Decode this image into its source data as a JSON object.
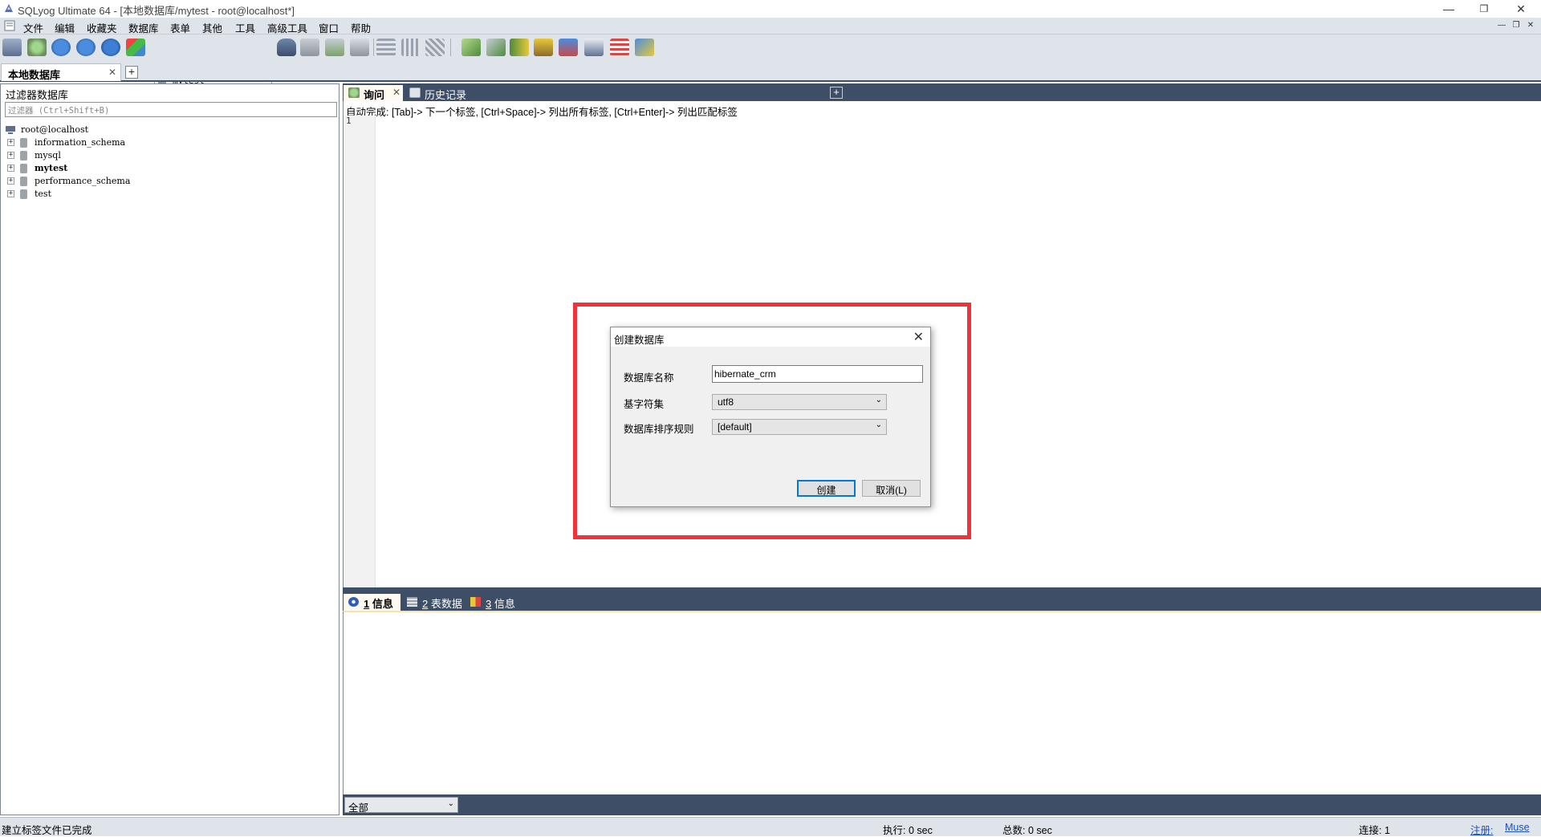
{
  "window": {
    "title": "SQLyog Ultimate 64 - [本地数据库/mytest - root@localhost*]",
    "controls": [
      "—",
      "❐",
      "✕"
    ]
  },
  "menu": {
    "items": [
      "文件",
      "编辑",
      "收藏夹",
      "数据库",
      "表单",
      "其他",
      "工具",
      "高级工具",
      "窗口",
      "帮助"
    ]
  },
  "toolbar": {
    "db_select": "mytest"
  },
  "connection": {
    "tab_label": "本地数据库",
    "close": "✕",
    "add": "+"
  },
  "object_browser": {
    "header": "过滤器数据库",
    "filter_placeholder": "过滤器 (Ctrl+Shift+B)",
    "root": "root@localhost",
    "databases": [
      {
        "name": "information_schema",
        "bold": false
      },
      {
        "name": "mysql",
        "bold": false
      },
      {
        "name": "mytest",
        "bold": true
      },
      {
        "name": "performance_schema",
        "bold": false
      },
      {
        "name": "test",
        "bold": false
      }
    ]
  },
  "query_tabs": {
    "query": "询问",
    "history": "历史记录",
    "close": "✕",
    "add": "+"
  },
  "editor": {
    "autocomplete_hint": "自动完成: [Tab]-> 下一个标签, [Ctrl+Space]-> 列出所有标签, [Ctrl+Enter]-> 列出匹配标签",
    "line_number": "1"
  },
  "result_tabs": {
    "info": {
      "num": "1",
      "label": "信息"
    },
    "table_data": {
      "num": "2",
      "label": "表数据"
    },
    "info3": {
      "num": "3",
      "label": "信息"
    }
  },
  "result_footer": {
    "scope": "全部"
  },
  "status": {
    "message": "建立标签文件已完成",
    "exec_label": "执行: 0 sec",
    "total_label": "总数: 0 sec",
    "conn_label": "连接: 1",
    "reg_label": "注册:",
    "reg_user": "Muse"
  },
  "dialog": {
    "title": "创建数据库",
    "close": "✕",
    "name_label": "数据库名称",
    "name_value": "hibernate_crm",
    "charset_label": "基字符集",
    "charset_value": "utf8",
    "collation_label": "数据库排序规则",
    "collation_value": "[default]",
    "create_button": "创建",
    "cancel_button": "取消(L)"
  },
  "colors": {
    "accent": "#3e4e67",
    "highlight": "#f0333a",
    "active_tab": "#fffaf0"
  }
}
